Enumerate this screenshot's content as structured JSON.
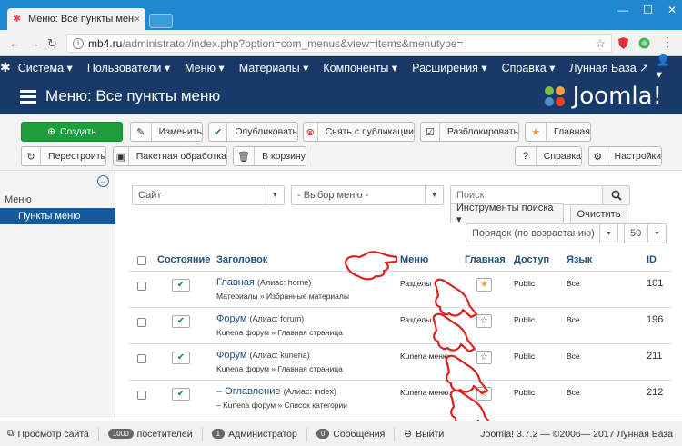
{
  "browser": {
    "tab_title": "Меню: Все пункты меню",
    "tab_close": "×",
    "url_host": "mb4.ru",
    "url_path": "/administrator/index.php?option=com_menus&view=items&menutype=",
    "window_buttons": [
      "—",
      "☐",
      "✕"
    ]
  },
  "menubar": {
    "items": [
      "Система ▾",
      "Пользователи ▾",
      "Меню ▾",
      "Материалы ▾",
      "Компоненты ▾",
      "Расширения ▾",
      "Справка ▾",
      "Лунная База ↗"
    ],
    "user": "👤 ▾"
  },
  "header": {
    "title": "Меню: Все пункты меню",
    "logo_text": "Joomla!"
  },
  "toolbar": {
    "create": "Создать",
    "edit": "Изменить",
    "publish": "Опубликовать",
    "unpublish": "Снять с публикации",
    "unlock": "Разблокировать",
    "home": "Главная",
    "rebuild": "Перестроить",
    "batch": "Пакетная обработка",
    "trash": "В корзину",
    "help": "Справка",
    "options": "Настройки"
  },
  "sidebar": {
    "items": [
      "Меню",
      "Пункты меню"
    ]
  },
  "filters": {
    "site": "Сайт",
    "menu": "- Выбор меню -",
    "search_placeholder": "Поиск",
    "search_tools": "Инструменты поиска ▾",
    "clear": "Очистить",
    "ordering": "Порядок (по возрастанию)",
    "limit": "50"
  },
  "table": {
    "headers": {
      "status": "Состояние",
      "title": "Заголовок",
      "menu": "Меню",
      "home": "Главная",
      "access": "Доступ",
      "language": "Язык",
      "id": "ID"
    },
    "rows": [
      {
        "title": "Главная",
        "alias": "(Алиас: home)",
        "path": "Материалы » Избранные материалы",
        "menu": "Разделы",
        "home": "★",
        "access": "Public",
        "language": "Все",
        "id": "101"
      },
      {
        "title": "Форум",
        "alias": "(Алиас: forum)",
        "path": "Kunena форум » Главная страница",
        "menu": "Разделы",
        "home": "☆",
        "access": "Public",
        "language": "Все",
        "id": "196"
      },
      {
        "title": "Форум",
        "alias": "(Алиас: kunena)",
        "path": "Kunena форум » Главная страница",
        "menu": "Kunena меню",
        "home": "☆",
        "access": "Public",
        "language": "Все",
        "id": "211"
      },
      {
        "title": "– Оглавление",
        "alias": "(Алиас: index)",
        "path": "– Kunena форум » Список категории",
        "menu": "Kunena меню",
        "home": "☆",
        "access": "Public",
        "language": "Все",
        "id": "212"
      }
    ]
  },
  "footer": {
    "preview": "Просмотр сайта",
    "visitors_count": "1000",
    "visitors": "посетителей",
    "admins_count": "1",
    "admins": "Администратор",
    "messages_count": "0",
    "messages": "Сообщения",
    "logout": "Выйти",
    "version": "Joomla! 3.7.2 — ©2006— 2017 Лунная База"
  }
}
